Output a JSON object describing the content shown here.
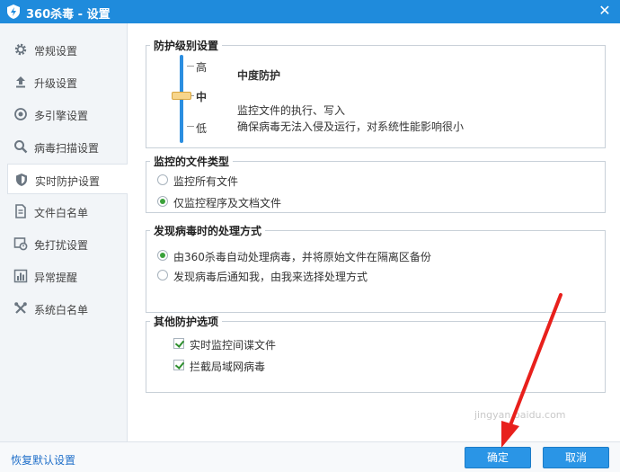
{
  "window": {
    "title": "360杀毒 - 设置",
    "close_icon": "close-icon"
  },
  "sidebar": {
    "items": [
      {
        "label": "常规设置",
        "icon": "gear-icon"
      },
      {
        "label": "升级设置",
        "icon": "upload-icon"
      },
      {
        "label": "多引擎设置",
        "icon": "engine-icon"
      },
      {
        "label": "病毒扫描设置",
        "icon": "search-icon"
      },
      {
        "label": "实时防护设置",
        "icon": "shield-icon",
        "active": true
      },
      {
        "label": "文件白名单",
        "icon": "document-icon"
      },
      {
        "label": "免打扰设置",
        "icon": "do-not-disturb-icon"
      },
      {
        "label": "异常提醒",
        "icon": "bar-chart-icon"
      },
      {
        "label": "系统白名单",
        "icon": "tools-icon"
      }
    ]
  },
  "protection_level": {
    "title": "防护级别设置",
    "levels": [
      "高",
      "中",
      "低"
    ],
    "selected": "中",
    "name": "中度防护",
    "desc_line1": "监控文件的执行、写入",
    "desc_line2": "确保病毒无法入侵及运行，对系统性能影响很小"
  },
  "file_types": {
    "title": "监控的文件类型",
    "options": [
      {
        "label": "监控所有文件",
        "checked": false
      },
      {
        "label": "仅监控程序及文档文件",
        "checked": true
      }
    ]
  },
  "virus_action": {
    "title": "发现病毒时的处理方式",
    "options": [
      {
        "label": "由360杀毒自动处理病毒，并将原始文件在隔离区备份",
        "checked": true
      },
      {
        "label": "发现病毒后通知我，由我来选择处理方式",
        "checked": false
      }
    ]
  },
  "other_options": {
    "title": "其他防护选项",
    "options": [
      {
        "label": "实时监控间谍文件",
        "checked": true
      },
      {
        "label": "拦截局域网病毒",
        "checked": true
      }
    ]
  },
  "footer": {
    "restore_label": "恢复默认设置",
    "ok_label": "确定",
    "cancel_label": "取消"
  },
  "watermark": "jingyan.baidu.com",
  "colors": {
    "titlebar": "#1f8bdc",
    "accent": "#2a95e6",
    "arrow": "#e8201c",
    "check": "#3aa13a"
  }
}
